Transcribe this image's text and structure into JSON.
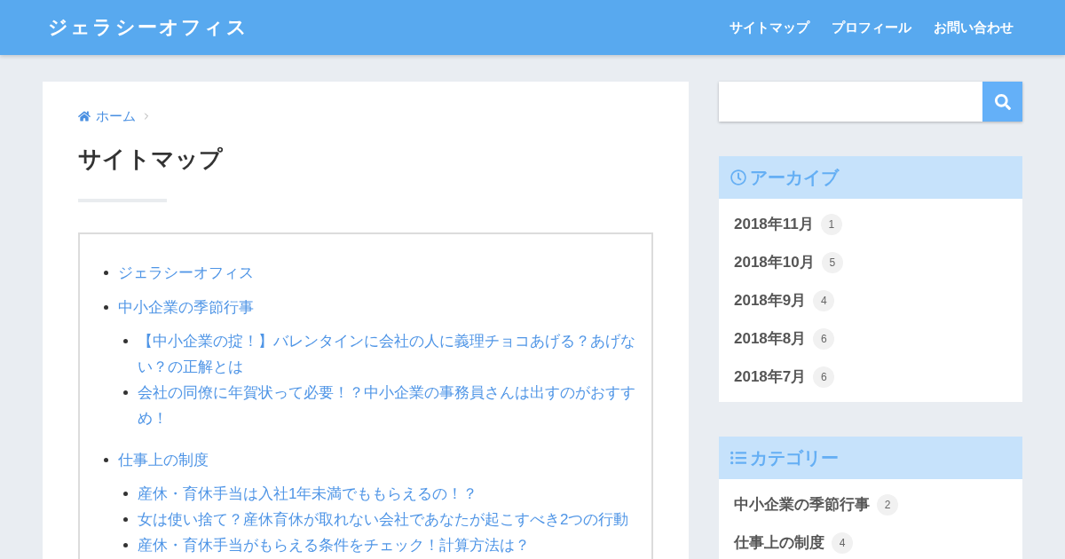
{
  "header": {
    "logo": "ジェラシーオフィス",
    "nav": [
      {
        "label": "サイトマップ"
      },
      {
        "label": "プロフィール"
      },
      {
        "label": "お問い合わせ"
      }
    ]
  },
  "breadcrumb": [
    {
      "label": "ホーム"
    }
  ],
  "page_title": "サイトマップ",
  "sitemap": [
    {
      "label": "ジェラシーオフィス"
    },
    {
      "label": "中小企業の季節行事",
      "children": [
        {
          "label": "【中小企業の掟！】バレンタインに会社の人に義理チョコあげる？あげない？の正解とは"
        },
        {
          "label": "会社の同僚に年賀状って必要！？中小企業の事務員さんは出すのがおすすめ！"
        }
      ]
    },
    {
      "label": "仕事上の制度",
      "children": [
        {
          "label": "産休・育休手当は入社1年未満でももらえるの！？"
        },
        {
          "label": "女は使い捨て？産休育休が取れない会社であなたが起こすべき2つの行動"
        },
        {
          "label": "産休・育休手当がもらえる条件をチェック！計算方法は？"
        }
      ]
    }
  ],
  "sidebar": {
    "widgets": [
      {
        "kind": "archive",
        "title": "アーカイブ",
        "items": [
          {
            "label": "2018年11月",
            "count": "1"
          },
          {
            "label": "2018年10月",
            "count": "5"
          },
          {
            "label": "2018年9月",
            "count": "4"
          },
          {
            "label": "2018年8月",
            "count": "6"
          },
          {
            "label": "2018年7月",
            "count": "6"
          }
        ]
      },
      {
        "kind": "categories",
        "title": "カテゴリー",
        "items": [
          {
            "label": "中小企業の季節行事",
            "count": "2"
          },
          {
            "label": "仕事上の制度",
            "count": "4"
          }
        ]
      }
    ]
  }
}
